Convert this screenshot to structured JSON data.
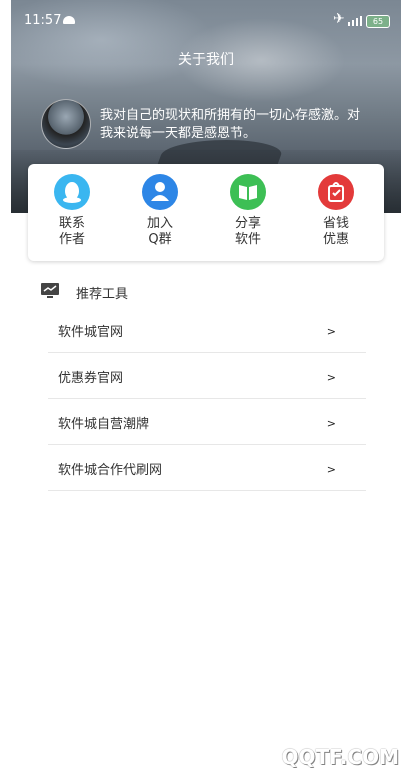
{
  "status_bar": {
    "time": "11:57",
    "battery": "65"
  },
  "header": {
    "title": "关于我们"
  },
  "profile": {
    "motto": "我对自己的现状和所拥有的一切心存感激。对我来说每一天都是感恩节。"
  },
  "actions": [
    {
      "label_line1": "联系",
      "label_line2": "作者",
      "icon": "qq-icon",
      "color": "#3ab6f0"
    },
    {
      "label_line1": "加入",
      "label_line2": "Q群",
      "icon": "group-icon",
      "color": "#2d86e6"
    },
    {
      "label_line1": "分享",
      "label_line2": "软件",
      "icon": "book-icon",
      "color": "#3dbf55"
    },
    {
      "label_line1": "省钱",
      "label_line2": "优惠",
      "icon": "coupon-icon",
      "color": "#e33a3a"
    }
  ],
  "section": {
    "title": "推荐工具",
    "icon": "monitor-chart-icon"
  },
  "list": [
    {
      "label": "软件城官网",
      "arrow": ">"
    },
    {
      "label": "优惠券官网",
      "arrow": ">"
    },
    {
      "label": "软件城自营潮牌",
      "arrow": ">"
    },
    {
      "label": "软件城合作代刷网",
      "arrow": ">"
    }
  ],
  "watermark": "QQTF.COM"
}
